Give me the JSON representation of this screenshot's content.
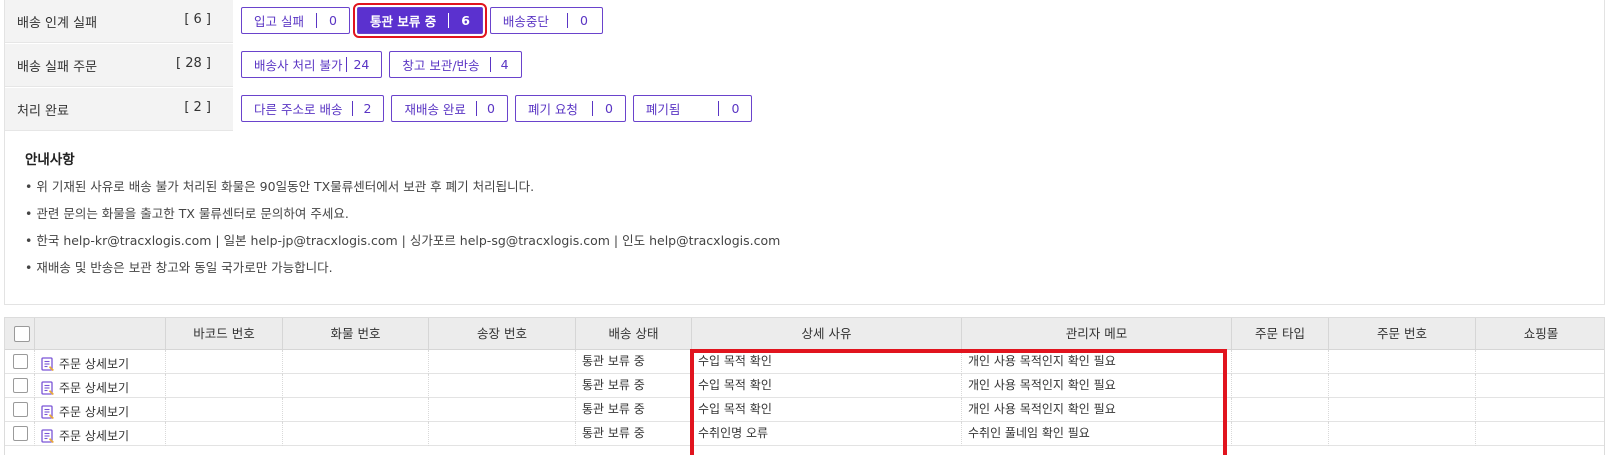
{
  "status_groups": [
    {
      "label": "배송 인계 실패",
      "count": "[ 6 ]",
      "chips": [
        {
          "label": "입고 실패",
          "count": "0",
          "active": false
        },
        {
          "label": "통관 보류 중",
          "count": "6",
          "active": true
        },
        {
          "label": "배송중단",
          "count": "0",
          "active": false
        }
      ]
    },
    {
      "label": "배송 실패 주문",
      "count": "[ 28 ]",
      "chips": [
        {
          "label": "배송사 처리 불가",
          "count": "24",
          "active": false
        },
        {
          "label": "창고 보관/반송",
          "count": "4",
          "active": false
        }
      ]
    },
    {
      "label": "처리 완료",
      "count": "[ 2 ]",
      "chips": [
        {
          "label": "다른 주소로 배송",
          "count": "2",
          "active": false
        },
        {
          "label": "재배송 완료",
          "count": "0",
          "active": false
        },
        {
          "label": "폐기 요청",
          "count": "0",
          "active": false
        },
        {
          "label": "폐기됨",
          "count": "0",
          "active": false
        }
      ]
    }
  ],
  "notice": {
    "title": "안내사항",
    "lines": [
      "• 위 기재된 사유로 배송 불가 처리된 화물은 90일동안 TX물류센터에서 보관 후 폐기 처리됩니다.",
      "• 관련 문의는 화물을 출고한 TX 물류센터로 문의하여 주세요.",
      "• 한국 help-kr@tracxlogis.com | 일본 help-jp@tracxlogis.com | 싱가포르 help-sg@tracxlogis.com | 인도 help@tracxlogis.com",
      "• 재배송 및 반송은 보관 창고와 동일 국가로만 가능합니다."
    ]
  },
  "table": {
    "headers": [
      "",
      "",
      "바코드 번호",
      "화물 번호",
      "송장 번호",
      "배송 상태",
      "상세 사유",
      "관리자 메모",
      "주문 타입",
      "주문 번호",
      "쇼핑몰"
    ],
    "detail_label": "주문 상세보기",
    "rows": [
      {
        "state": "통관 보류 중",
        "reason": "수입 목적 확인",
        "memo": "개인 사용 목적인지 확인 필요"
      },
      {
        "state": "통관 보류 중",
        "reason": "수입 목적 확인",
        "memo": "개인 사용 목적인지 확인 필요"
      },
      {
        "state": "통관 보류 중",
        "reason": "수입 목적 확인",
        "memo": "개인 사용 목적인지 확인 필요"
      },
      {
        "state": "통관 보류 중",
        "reason": "수취인명 오류",
        "memo": "수취인 풀네임 확인 필요"
      }
    ]
  }
}
